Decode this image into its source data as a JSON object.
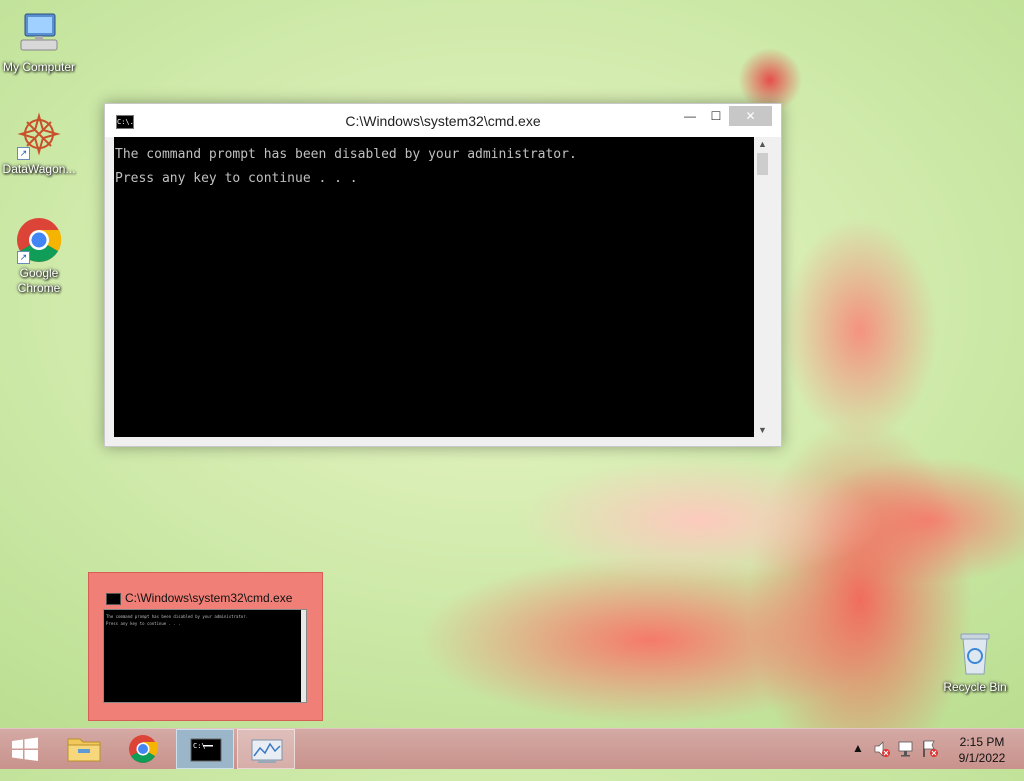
{
  "desktop": {
    "icons": [
      {
        "label": "My Computer"
      },
      {
        "label": "DataWagon..."
      },
      {
        "label": "Google Chrome"
      },
      {
        "label": "Recycle Bin"
      }
    ]
  },
  "window": {
    "title": "C:\\Windows\\system32\\cmd.exe",
    "icon_text": "C:\\.",
    "buttons": {
      "minimize": "—",
      "maximize": "☐",
      "close": "✕"
    },
    "console_lines": [
      "The command prompt has been disabled by your administrator.",
      "Press any key to continue . . ."
    ],
    "scroll_up": "▲",
    "scroll_down": "▼"
  },
  "thumbnail": {
    "title": "C:\\Windows\\system32\\cmd.exe",
    "lines": [
      "The command prompt has been disabled by your administrator.",
      "Press any key to continue . . ."
    ]
  },
  "taskbar": {
    "start_icon": "windows-logo",
    "pinned": [
      "file-explorer-icon",
      "chrome-icon",
      "cmd-icon",
      "resource-monitor-icon"
    ],
    "tray": {
      "chevron": "▲",
      "time": "2:15 PM",
      "date": "9/1/2022"
    }
  },
  "colors": {
    "taskbar": "#c9928c",
    "console_bg": "#000000",
    "console_fg": "#c0c0c0",
    "preview_bg": "#f08077"
  }
}
